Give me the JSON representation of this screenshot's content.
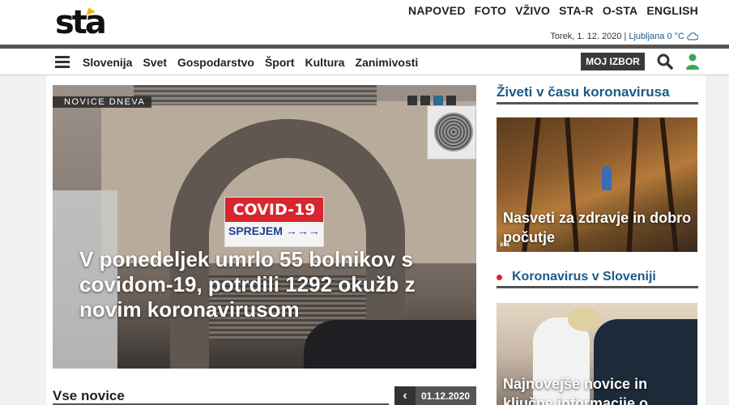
{
  "logo": {
    "text": "sta"
  },
  "topnav": [
    "NAPOVED",
    "FOTO",
    "VŽIVO",
    "STA-R",
    "O-STA",
    "ENGLISH"
  ],
  "dateline": {
    "date": "Torek, 1. 12. 2020 |",
    "weather": "Ljubljana 0 °C"
  },
  "mainnav": [
    "Slovenija",
    "Svet",
    "Gospodarstvo",
    "Šport",
    "Kultura",
    "Zanimivosti"
  ],
  "my_select": "MOJ IZBOR",
  "hero": {
    "label": "NOVICE DNEVA",
    "title": "V ponedeljek umrlo 55 bolnikov s covidom-19, potrdili 1292 okužb z novim koronavirusom",
    "sign_top": "COVID-19",
    "sign_bottom": "SPREJEM →→→",
    "slides": 4,
    "active_slide": 3
  },
  "news": {
    "heading": "Vse novice",
    "date": "01.12.2020",
    "prev": "‹"
  },
  "sidebar": {
    "heading1": "Živeti v času koronavirusa",
    "card1": "Nasveti za zdravje in dobro počutje",
    "card1_badge": "sta",
    "heading2": "Koronavirus v Sloveniji",
    "card2": "Najnovejše novice in ključne informacije o"
  },
  "colors": {
    "accent_blue": "#1c5a87",
    "covid_red": "#d7262d",
    "logo_yellow": "#f2b300"
  },
  "icons": {
    "menu": "hamburger-icon",
    "search": "search-icon",
    "user": "user-icon",
    "weather": "cloud-icon"
  }
}
